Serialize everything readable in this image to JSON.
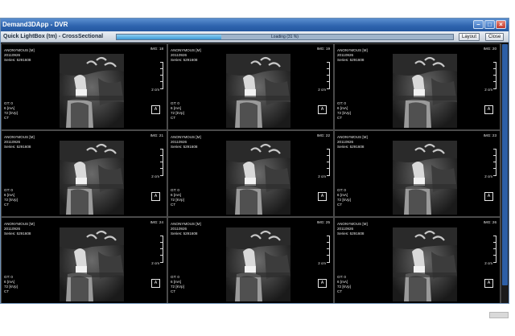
{
  "window": {
    "title": "Demand3DApp - DVR"
  },
  "toolbar": {
    "view_title": "Quick LightBox (tm) - CrossSectional",
    "progress_label": "Loading (31 %)",
    "progress_value": 31,
    "layout_label": "Layout",
    "close_label": "Close"
  },
  "cells": [
    {
      "patient": "ANONYMOUS [M]",
      "date": "20110926",
      "series": "Series: 5291608",
      "img": "IMG: 18",
      "gt": "GT: 0",
      "ma": "6 [mA]",
      "kvp": "72 [kVp]",
      "modality": "CT",
      "scale": "2 cm",
      "orient": "A"
    },
    {
      "patient": "ANONYMOUS [M]",
      "date": "20110926",
      "series": "Series: 5291608",
      "img": "IMG: 19",
      "gt": "GT: 0",
      "ma": "6 [mA]",
      "kvp": "72 [kVp]",
      "modality": "CT",
      "scale": "2 cm",
      "orient": "A"
    },
    {
      "patient": "ANONYMOUS [M]",
      "date": "20110926",
      "series": "Series: 5291608",
      "img": "IMG: 20",
      "gt": "GT: 0",
      "ma": "6 [mA]",
      "kvp": "72 [kVp]",
      "modality": "CT",
      "scale": "2 cm",
      "orient": "A"
    },
    {
      "patient": "ANONYMOUS [M]",
      "date": "20110926",
      "series": "Series: 5291608",
      "img": "IMG: 21",
      "gt": "GT: 0",
      "ma": "6 [mA]",
      "kvp": "72 [kVp]",
      "modality": "CT",
      "scale": "2 cm",
      "orient": "A"
    },
    {
      "patient": "ANONYMOUS [M]",
      "date": "20110926",
      "series": "Series: 5291608",
      "img": "IMG: 22",
      "gt": "GT: 0",
      "ma": "6 [mA]",
      "kvp": "72 [kVp]",
      "modality": "CT",
      "scale": "2 cm",
      "orient": "A"
    },
    {
      "patient": "ANONYMOUS [M]",
      "date": "20110926",
      "series": "Series: 5291608",
      "img": "IMG: 23",
      "gt": "GT: 0",
      "ma": "6 [mA]",
      "kvp": "72 [kVp]",
      "modality": "CT",
      "scale": "2 cm",
      "orient": "A"
    },
    {
      "patient": "ANONYMOUS [M]",
      "date": "20110926",
      "series": "Series: 5291608",
      "img": "IMG: 24",
      "gt": "GT: 0",
      "ma": "6 [mA]",
      "kvp": "72 [kVp]",
      "modality": "CT",
      "scale": "2 cm",
      "orient": "A"
    },
    {
      "patient": "ANONYMOUS [M]",
      "date": "20110926",
      "series": "Series: 5291608",
      "img": "IMG: 25",
      "gt": "GT: 0",
      "ma": "6 [mA]",
      "kvp": "72 [kVp]",
      "modality": "CT",
      "scale": "2 cm",
      "orient": "A"
    },
    {
      "patient": "ANONYMOUS [M]",
      "date": "20110926",
      "series": "Series: 5291608",
      "img": "IMG: 26",
      "gt": "GT: 0",
      "ma": "6 [mA]",
      "kvp": "72 [kVp]",
      "modality": "CT",
      "scale": "2 cm",
      "orient": "A"
    }
  ],
  "icons": {
    "minimize": "minimize-icon",
    "maximize": "maximize-icon",
    "close": "close-icon"
  },
  "colors": {
    "titlebar": "#2d63ad",
    "progress": "#3b9ad6",
    "scrollbar": "#2d5fa6"
  }
}
